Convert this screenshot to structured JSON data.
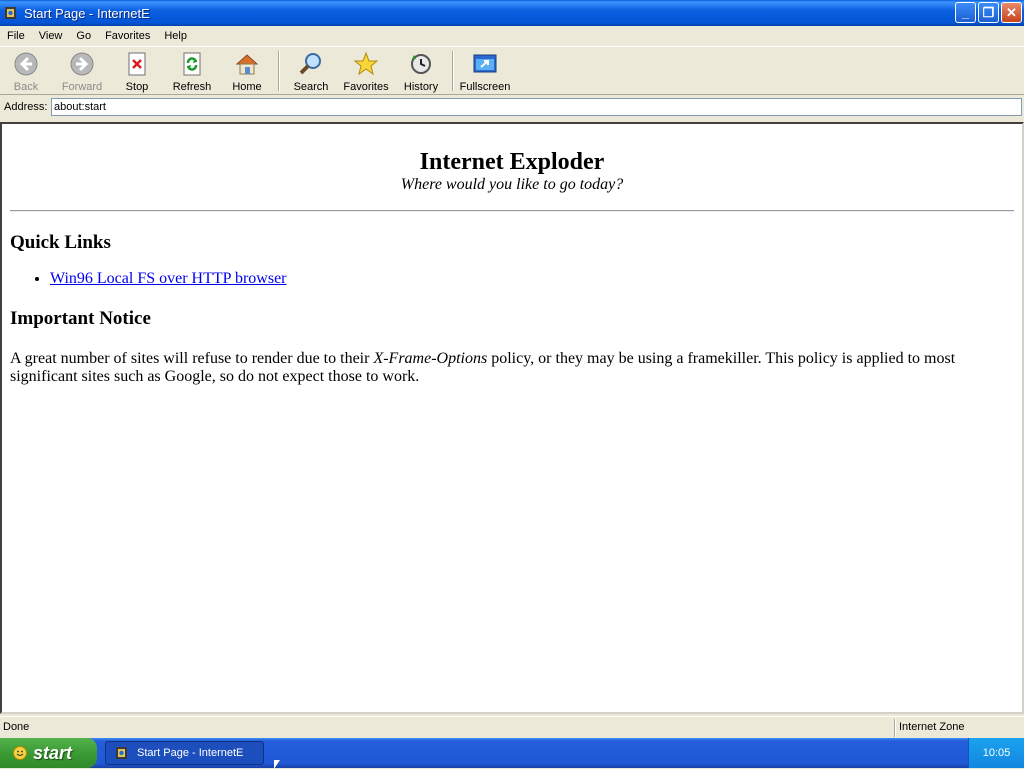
{
  "window": {
    "title": "Start Page - InternetE"
  },
  "menubar": {
    "items": [
      "File",
      "View",
      "Go",
      "Favorites",
      "Help"
    ]
  },
  "toolbar": {
    "back": "Back",
    "forward": "Forward",
    "stop": "Stop",
    "refresh": "Refresh",
    "home": "Home",
    "search": "Search",
    "favorites": "Favorites",
    "history": "History",
    "fullscreen": "Fullscreen"
  },
  "address": {
    "label": "Address:",
    "value": "about:start"
  },
  "page": {
    "title": "Internet Exploder",
    "subtitle": "Where would you like to go today?",
    "quick_links_heading": "Quick Links",
    "links": [
      "Win96 Local FS over HTTP browser"
    ],
    "notice_heading": "Important Notice",
    "notice_text_before": "A great number of sites will refuse to render due to their ",
    "notice_text_em": "X-Frame-Options",
    "notice_text_after": " policy, or they may be using a framekiller. This policy is applied to most significant sites such as Google, so do not expect those to work."
  },
  "statusbar": {
    "status": "Done",
    "zone": "Internet Zone"
  },
  "taskbar": {
    "start_label": "start",
    "task_label": "Start Page - InternetE",
    "clock": "10:05"
  },
  "icons": {
    "app": "internet-exploder-icon",
    "back": "back-arrow-icon",
    "forward": "forward-arrow-icon",
    "stop": "stop-icon",
    "refresh": "refresh-icon",
    "home": "home-icon",
    "search": "magnifier-icon",
    "favorites": "star-icon",
    "history": "history-icon",
    "fullscreen": "fullscreen-icon"
  },
  "colors": {
    "titlebar": "#0a5fd8",
    "link": "#0000ee",
    "taskbar": "#245edb",
    "start": "#3c9b34"
  }
}
